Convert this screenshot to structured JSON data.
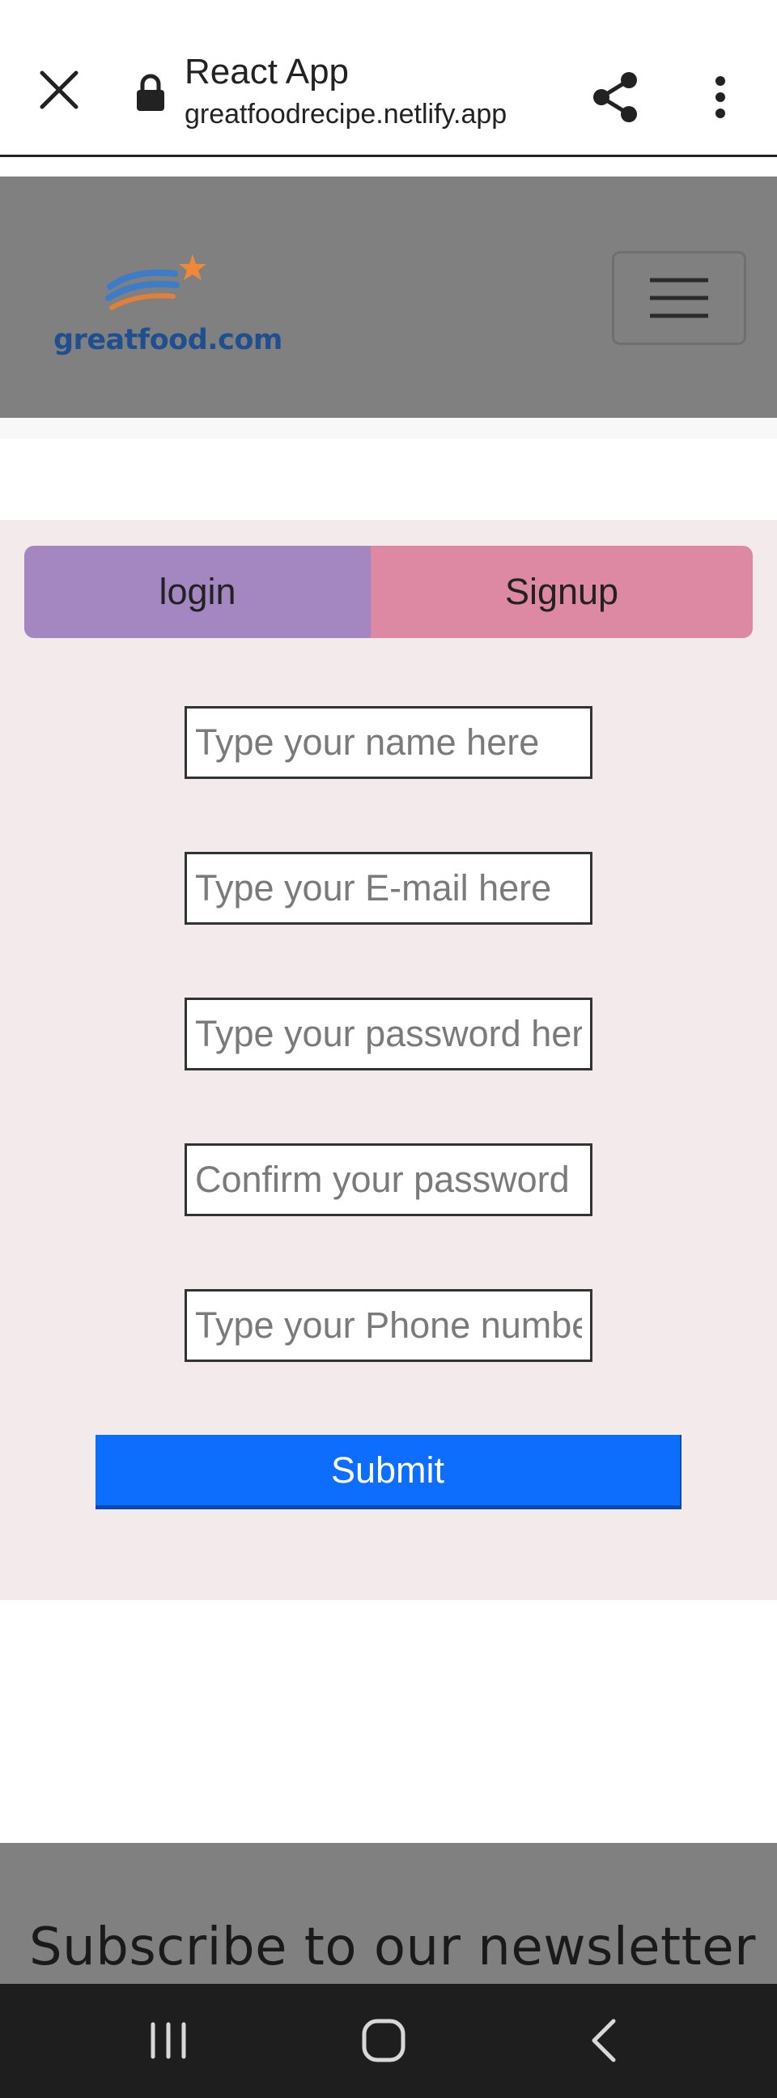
{
  "browser": {
    "page_title": "React App",
    "url": "greatfoodrecipe.netlify.app",
    "icons": [
      "close-icon",
      "lock-icon",
      "share-icon",
      "more-vert-icon"
    ]
  },
  "navbar": {
    "brand": "greatfood.com",
    "icons": [
      "hamburger-icon"
    ]
  },
  "auth": {
    "tabs": {
      "login_label": "login",
      "signup_label": "Signup"
    },
    "fields": {
      "name_placeholder": "Type your name here",
      "email_placeholder": "Type your E-mail here",
      "password_placeholder": "Type your password here",
      "confirm_placeholder": "Confirm your password",
      "phone_placeholder": "Type your Phone number"
    },
    "submit_label": "Submit"
  },
  "footer": {
    "newsletter_title": "Subscribe to our newsletter"
  },
  "system_nav": {
    "icons": [
      "recent-apps-icon",
      "home-icon",
      "back-icon"
    ]
  },
  "colors": {
    "navbar_bg": "#808080",
    "form_bg": "#f3ebeb",
    "login_tab": "#a487c0",
    "signup_tab": "#de89a3",
    "submit": "#0d6efd",
    "brand_text": "#1f4f8f",
    "logo_swoosh": "#3d7cc9",
    "logo_star": "#f0883a",
    "system_nav_bg": "#1e1e1e"
  }
}
